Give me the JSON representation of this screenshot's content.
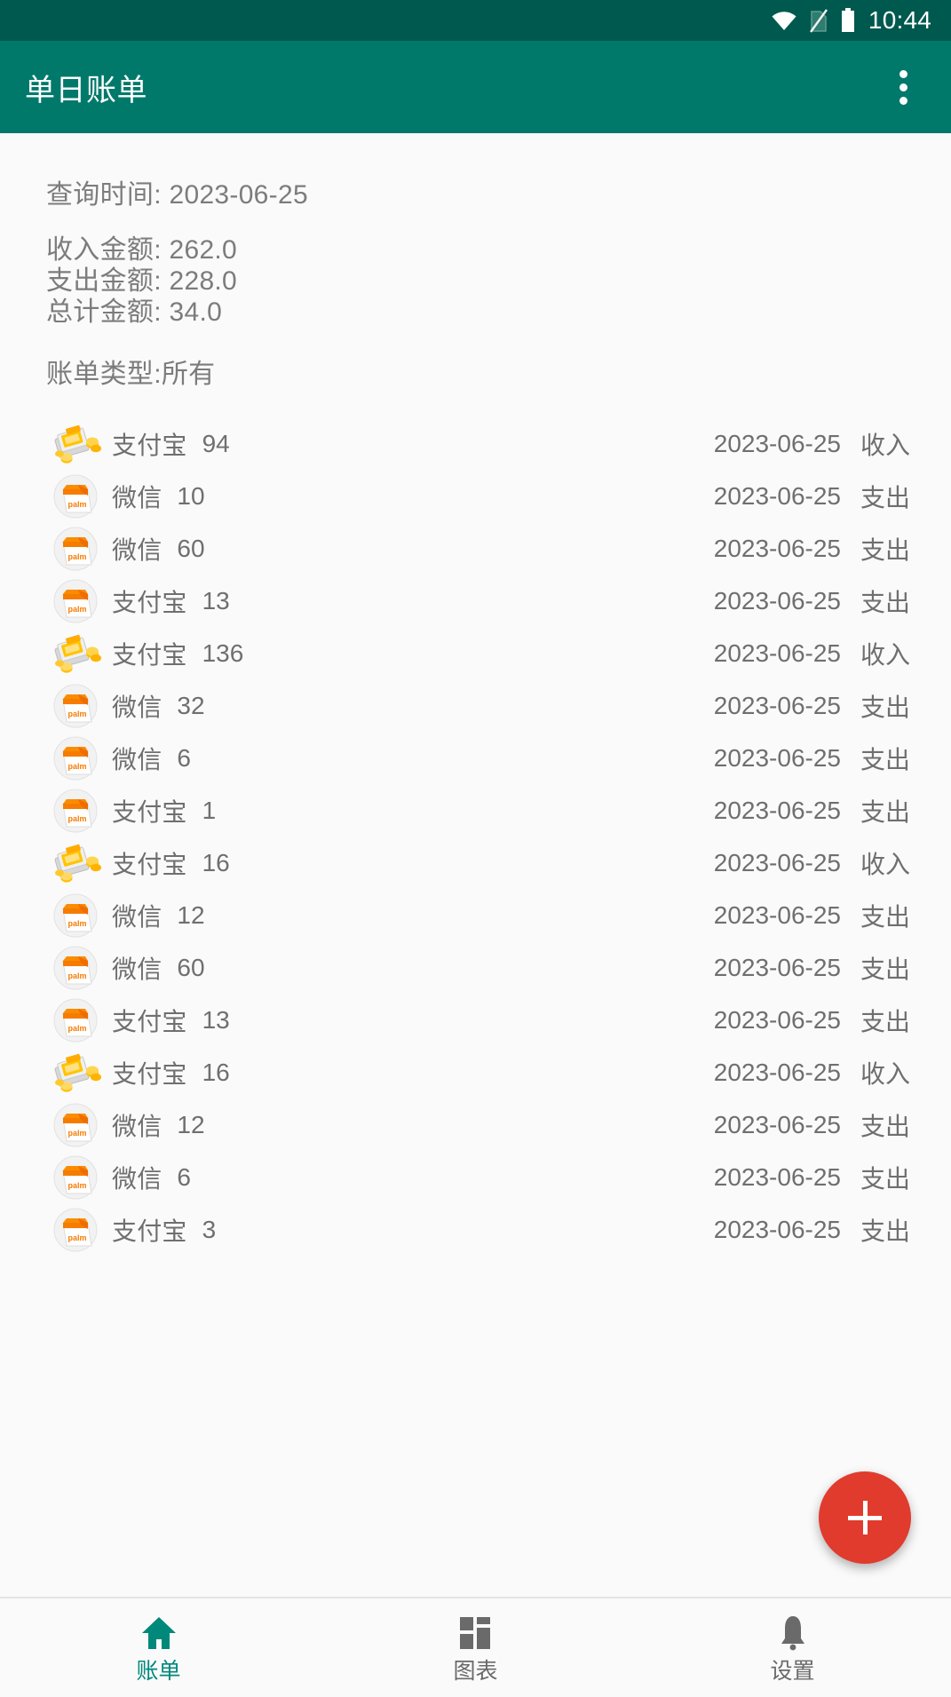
{
  "status_bar": {
    "time": "10:44",
    "icons": [
      "wifi-icon",
      "no-sim-icon",
      "battery-icon"
    ]
  },
  "app_bar": {
    "title": "单日账单",
    "overflow_icon": "more-vertical-icon"
  },
  "summary": {
    "query_time_label": "查询时间: 2023-06-25",
    "income_label": "收入金额: 262.0",
    "expense_label": "支出金额: 228.0",
    "total_label": "总计金额: 34.0",
    "bill_type_label": "账单类型:所有"
  },
  "colors": {
    "appbar": "#00796b",
    "statusbar": "#00594e",
    "fab": "#e03b2d",
    "accent": "#00897b",
    "text": "#6f6f6f",
    "background": "#fafafa"
  },
  "bills": [
    {
      "icon": "income-money-icon",
      "source": "支付宝",
      "amount": "94",
      "date": "2023-06-25",
      "type": "收入"
    },
    {
      "icon": "expense-bag-icon",
      "source": "微信",
      "amount": "10",
      "date": "2023-06-25",
      "type": "支出"
    },
    {
      "icon": "expense-bag-icon",
      "source": "微信",
      "amount": "60",
      "date": "2023-06-25",
      "type": "支出"
    },
    {
      "icon": "expense-bag-icon",
      "source": "支付宝",
      "amount": "13",
      "date": "2023-06-25",
      "type": "支出"
    },
    {
      "icon": "income-money-icon",
      "source": "支付宝",
      "amount": "136",
      "date": "2023-06-25",
      "type": "收入"
    },
    {
      "icon": "expense-bag-icon",
      "source": "微信",
      "amount": "32",
      "date": "2023-06-25",
      "type": "支出"
    },
    {
      "icon": "expense-bag-icon",
      "source": "微信",
      "amount": "6",
      "date": "2023-06-25",
      "type": "支出"
    },
    {
      "icon": "expense-bag-icon",
      "source": "支付宝",
      "amount": "1",
      "date": "2023-06-25",
      "type": "支出"
    },
    {
      "icon": "income-money-icon",
      "source": "支付宝",
      "amount": "16",
      "date": "2023-06-25",
      "type": "收入"
    },
    {
      "icon": "expense-bag-icon",
      "source": "微信",
      "amount": "12",
      "date": "2023-06-25",
      "type": "支出"
    },
    {
      "icon": "expense-bag-icon",
      "source": "微信",
      "amount": "60",
      "date": "2023-06-25",
      "type": "支出"
    },
    {
      "icon": "expense-bag-icon",
      "source": "支付宝",
      "amount": "13",
      "date": "2023-06-25",
      "type": "支出"
    },
    {
      "icon": "income-money-icon",
      "source": "支付宝",
      "amount": "16",
      "date": "2023-06-25",
      "type": "收入"
    },
    {
      "icon": "expense-bag-icon",
      "source": "微信",
      "amount": "12",
      "date": "2023-06-25",
      "type": "支出"
    },
    {
      "icon": "expense-bag-icon",
      "source": "微信",
      "amount": "6",
      "date": "2023-06-25",
      "type": "支出"
    },
    {
      "icon": "expense-bag-icon",
      "source": "支付宝",
      "amount": "3",
      "date": "2023-06-25",
      "type": "支出"
    }
  ],
  "fab": {
    "icon": "plus-icon",
    "label": "+"
  },
  "bottom_nav": {
    "items": [
      {
        "label": "账单",
        "icon": "home-icon",
        "active": true
      },
      {
        "label": "图表",
        "icon": "dashboard-icon",
        "active": false
      },
      {
        "label": "设置",
        "icon": "bell-icon",
        "active": false
      }
    ]
  }
}
